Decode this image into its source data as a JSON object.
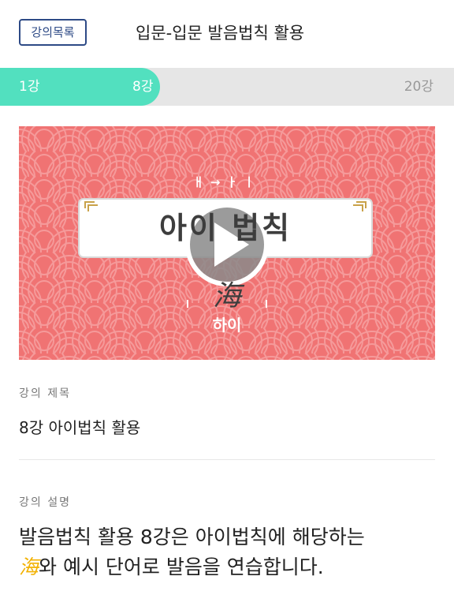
{
  "header": {
    "list_button": "강의목록",
    "title": "입문-입문 발음법칙 활용"
  },
  "progress": {
    "start_label": "1강",
    "current_label": "8강",
    "end_label": "20강",
    "current": 8,
    "total": 20
  },
  "video": {
    "vowel_label": "ㅐ→ㅏㅣ",
    "title": "아이 법칙",
    "hanja": "海",
    "reading": "하이",
    "colors": {
      "background": "#f07373",
      "title_box": "#ffffff",
      "play_overlay": "#8a8a8a"
    },
    "play_icon": "play-icon"
  },
  "info": {
    "title_label": "강의 제목",
    "title_value": "8강 아이법칙 활용",
    "desc_label": "강의 설명",
    "desc_line1": "발음법칙 활용 8강은 아이법칙에 해당하는",
    "desc_hanja": "海",
    "desc_line2_rest": "와 예시 단어로 발음을 연습합니다."
  },
  "colors": {
    "accent": "#52e0bf",
    "brand_blue": "#2d4a86",
    "progress_track": "#e6e6e6",
    "highlight": "#f2b100"
  }
}
